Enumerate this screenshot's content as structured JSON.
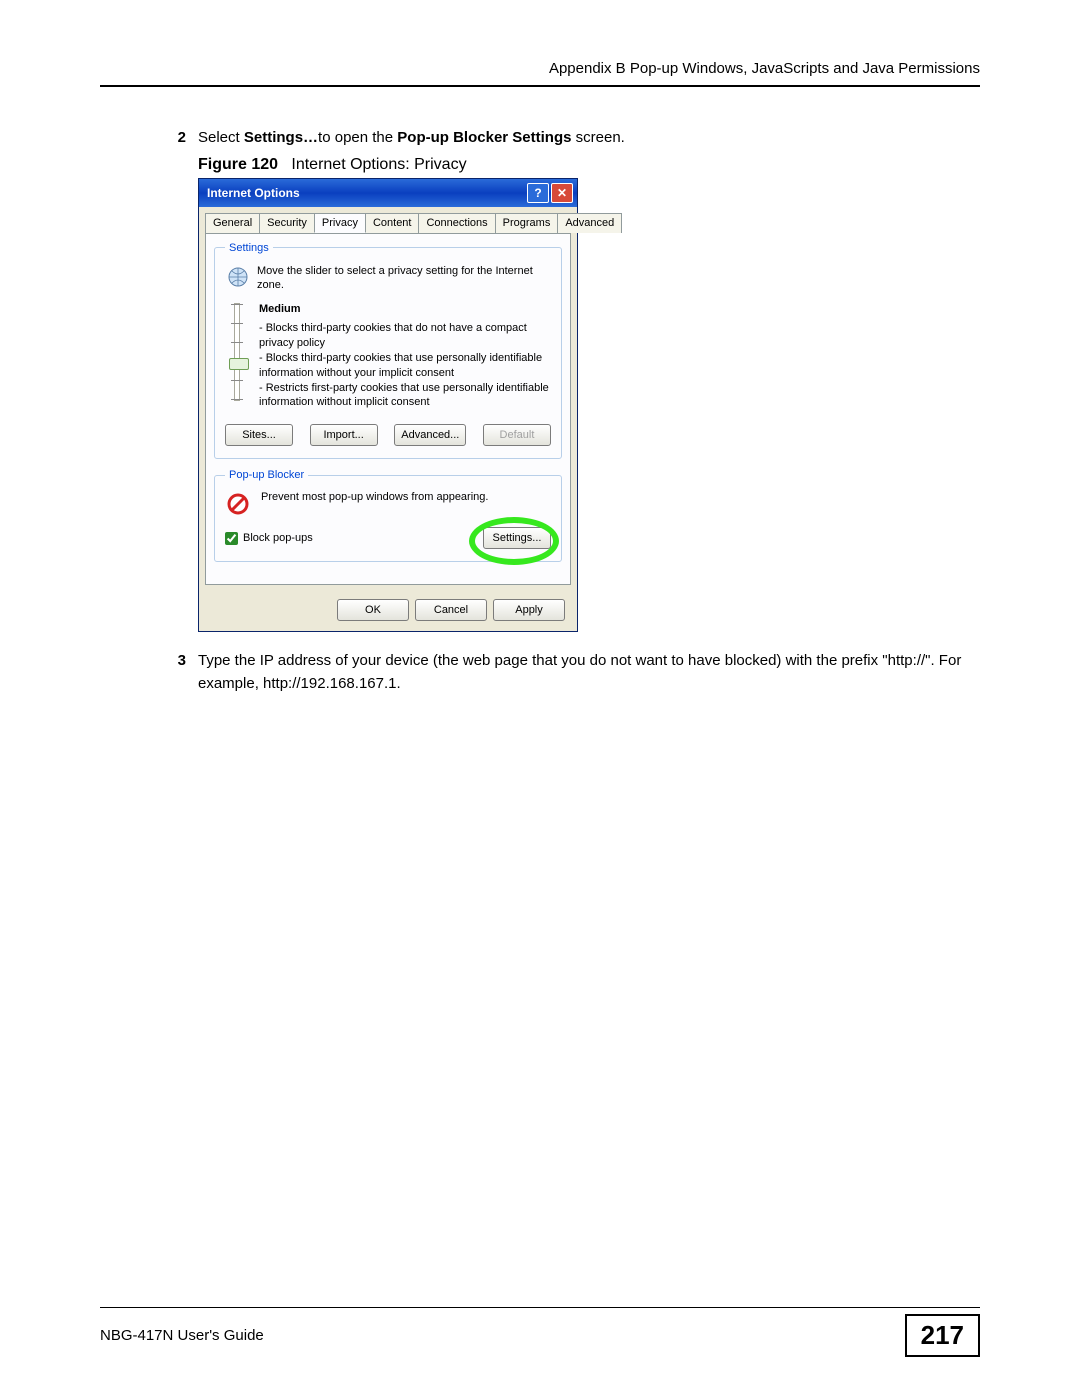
{
  "header": "Appendix B Pop-up Windows, JavaScripts and Java Permissions",
  "step2": {
    "num": "2",
    "pre": "Select ",
    "bold1": "Settings…",
    "mid": "to open the ",
    "bold2": "Pop-up Blocker Settings",
    "post": " screen."
  },
  "figure": {
    "label": "Figure 120",
    "caption": "Internet Options: Privacy"
  },
  "dialog": {
    "title": "Internet Options",
    "tabs": [
      "General",
      "Security",
      "Privacy",
      "Content",
      "Connections",
      "Programs",
      "Advanced"
    ],
    "active_tab": "Privacy",
    "settings_group": {
      "legend": "Settings",
      "intro": "Move the slider to select a privacy setting for the Internet zone.",
      "level": "Medium",
      "bullets": [
        "- Blocks third-party cookies that do not have a compact privacy policy",
        "- Blocks third-party cookies that use personally identifiable information without your implicit consent",
        "- Restricts first-party cookies that use personally identifiable information without implicit consent"
      ],
      "buttons": {
        "sites": "Sites...",
        "import": "Import...",
        "advanced": "Advanced...",
        "default": "Default"
      }
    },
    "popup_group": {
      "legend": "Pop-up Blocker",
      "desc": "Prevent most pop-up windows from appearing.",
      "checkbox": "Block pop-ups",
      "settings_btn": "Settings..."
    },
    "bottom": {
      "ok": "OK",
      "cancel": "Cancel",
      "apply": "Apply"
    }
  },
  "step3": {
    "num": "3",
    "text": "Type the IP address of your device (the web page that you do not want to have blocked) with the prefix \"http://\". For example, http://192.168.167.1."
  },
  "footer": {
    "guide": "NBG-417N User's Guide",
    "page": "217"
  }
}
